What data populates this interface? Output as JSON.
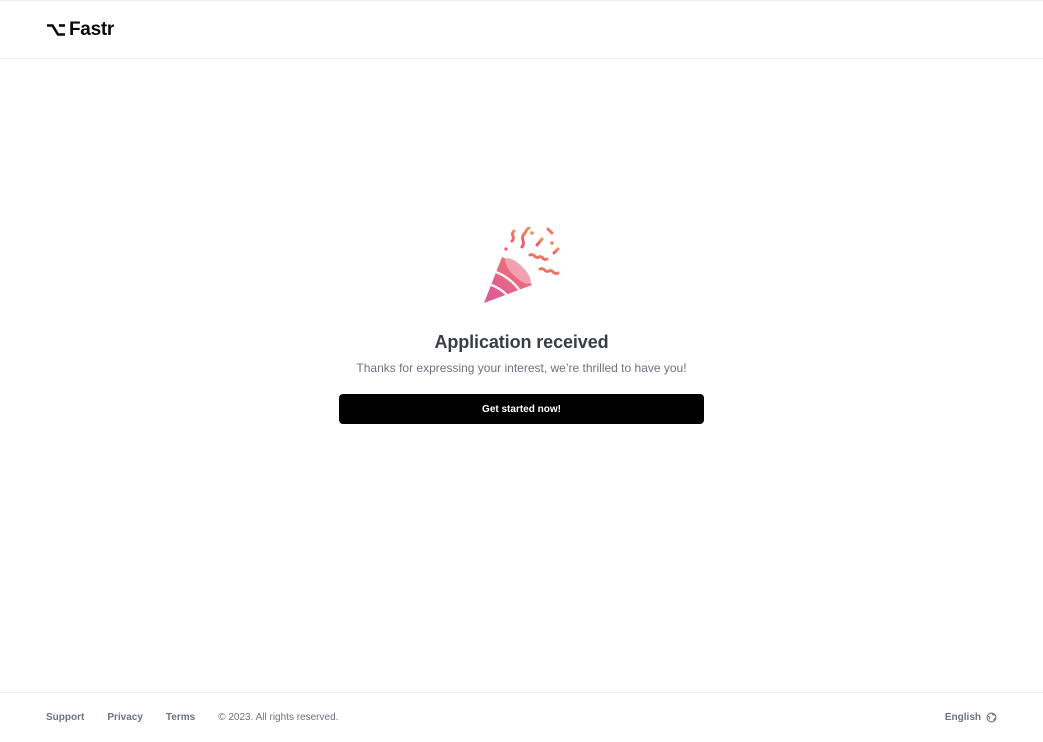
{
  "header": {
    "logo_text": "Fastr",
    "logo_icon": "option-key-icon"
  },
  "main": {
    "icon": "party-popper-icon",
    "title": "Application received",
    "subtitle": "Thanks for expressing your interest, we’re thrilled to have you!",
    "cta_label": "Get started now!"
  },
  "footer": {
    "links": [
      {
        "label": "Support"
      },
      {
        "label": "Privacy"
      },
      {
        "label": "Terms"
      }
    ],
    "copyright": "© 2023. All rights reserved.",
    "language": "English",
    "language_icon": "globe-icon"
  },
  "colors": {
    "brand": "#000000",
    "text_heading": "#3a3d45",
    "text_muted": "#6b7280",
    "border": "#eceef2",
    "confetti_pink": "#e0568f",
    "confetti_orange": "#f08a4b"
  }
}
